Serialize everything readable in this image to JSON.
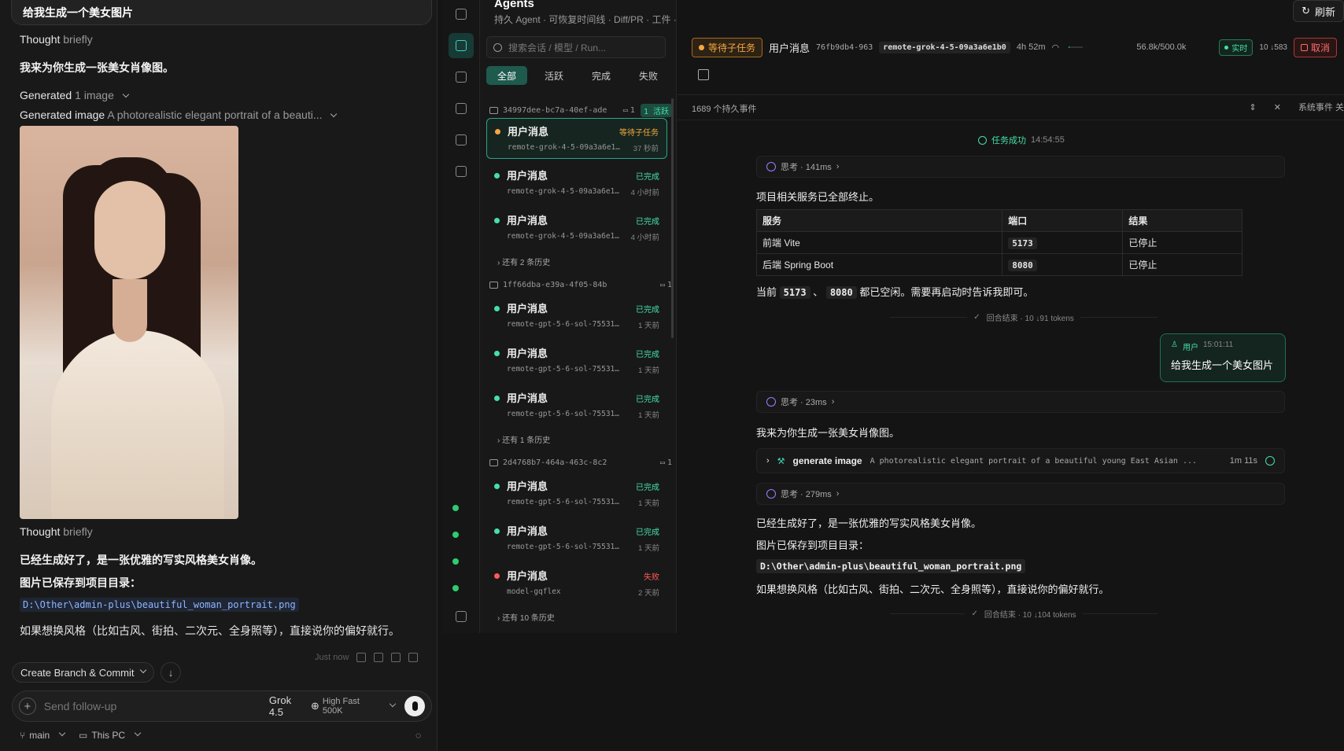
{
  "chat": {
    "user_prompt": "给我生成一个美女图片",
    "thought_label": "Thought",
    "thought_suffix": "briefly",
    "reply_intro": "我来为你生成一张美女肖像图。",
    "generated_label": "Generated",
    "generated_count": "1 image",
    "generated_image_label": "Generated image",
    "generated_image_desc": "A photorealistic elegant portrait of a beauti...",
    "thought2_label": "Thought",
    "thought2_suffix": "briefly",
    "reply_done": "已经生成好了，是一张优雅的写实风格美女肖像。",
    "reply_saved": "图片已保存到项目目录：",
    "file_path": "D:\\Other\\admin-plus\\beautiful_woman_portrait.png",
    "reply_style": "如果想换风格（比如古风、街拍、二次元、全身照等），直接说你的偏好就行。",
    "timestamp": "Just now",
    "branch_button": "Create Branch & Commit",
    "composer_placeholder": "Send follow-up",
    "model_name": "Grok 4.5",
    "model_mode": "High Fast 500K",
    "branch": "main",
    "location": "This PC"
  },
  "sessions": {
    "title": "Agents",
    "subtitle": "持久 Agent · 可恢复时间线 · Diff/PR · 工件 · 本地/远程交接",
    "search_placeholder": "搜索会话 / 模型 / Run...",
    "filters": [
      "全部",
      "活跃",
      "完成",
      "失败"
    ],
    "groups": [
      {
        "id": "34997dee-bc7a-40ef-ade",
        "count": "1",
        "active": "1 活跃"
      },
      {
        "id": "1ff66dba-e39a-4f05-84b",
        "count": "1"
      },
      {
        "id": "2d4768b7-464a-463c-8c2",
        "count": "1"
      }
    ],
    "items": [
      {
        "title": "用户消息",
        "status": "等待子任务",
        "sub": "remote-grok-4-5-09a3a6e1b0",
        "ago": "37 秒前"
      },
      {
        "title": "用户消息",
        "status": "已完成",
        "sub": "remote-grok-4-5-09a3a6e1b0",
        "ago": "4 小时前"
      },
      {
        "title": "用户消息",
        "status": "已完成",
        "sub": "remote-grok-4-5-09a3a6e1b0",
        "ago": "4 小时前"
      },
      {
        "title": "用户消息",
        "status": "已完成",
        "sub": "remote-gpt-5-6-sol-755311b",
        "ago": "1 天前"
      },
      {
        "title": "用户消息",
        "status": "已完成",
        "sub": "remote-gpt-5-6-sol-755311b",
        "ago": "1 天前"
      },
      {
        "title": "用户消息",
        "status": "已完成",
        "sub": "remote-gpt-5-6-sol-755311b",
        "ago": "1 天前"
      },
      {
        "title": "用户消息",
        "status": "已完成",
        "sub": "remote-gpt-5-6-sol-755311b",
        "ago": "1 天前"
      },
      {
        "title": "用户消息",
        "status": "已完成",
        "sub": "remote-gpt-5-6-sol-755311b",
        "ago": "1 天前"
      },
      {
        "title": "用户消息",
        "status": "失败",
        "sub": "model-gqflex",
        "ago": "2 天前"
      }
    ],
    "more": [
      "还有 2 条历史",
      "还有 1 条历史",
      "还有 10 条历史"
    ]
  },
  "task": {
    "refresh": "刷新",
    "waiting": "等待子任务",
    "msg_label": "用户消息",
    "msg_id": "76fb9db4-963",
    "run_id": "remote-grok-4-5-09a3a6e1b0",
    "elapsed": "4h 52m",
    "progress": 0.05,
    "tokens": "56.8k/500.0k",
    "realtime": "实时",
    "counts": "10 ↓583",
    "cancel": "取消",
    "event_count": "1689 个持久事件",
    "system_events": "系统事件 关",
    "success_label": "任务成功",
    "success_time": "14:54:55",
    "think1": "思考 · 141ms",
    "stopped": "项目相关服务已全部终止。",
    "table_headers": [
      "服务",
      "端口",
      "结果"
    ],
    "table_rows": [
      [
        "前端 Vite",
        "5173",
        "已停止"
      ],
      [
        "后端 Spring Boot",
        "8080",
        "已停止"
      ]
    ],
    "ports_prefix": "当前",
    "port_a": "5173",
    "port_sep": "、",
    "port_b": "8080",
    "ports_suffix": "都已空闲。需要再启动时告诉我即可。",
    "round_end1": "回合结束 · 10 ↓91 tokens",
    "user_label": "用户",
    "user_time": "15:01:11",
    "user_text": "给我生成一个美女图片",
    "think2": "思考 · 23ms",
    "intro": "我来为你生成一张美女肖像图。",
    "tool_name": "generate image",
    "tool_args": "A photorealistic elegant portrait of a beautiful young East Asian ...",
    "tool_dur": "1m 11s",
    "think3": "思考 · 279ms",
    "done": "已经生成好了，是一张优雅的写实风格美女肖像。",
    "saved": "图片已保存到项目目录：",
    "path": "D:\\Other\\admin-plus\\beautiful_woman_portrait.png",
    "style": "如果想换风格（比如古风、街拍、二次元、全身照等），直接说你的偏好就行。",
    "round_end2": "回合结束 · 10 ↓104 tokens"
  },
  "colors": {
    "accent": "#3fd3b8",
    "success": "#45e0a8",
    "waiting": "#f4a742",
    "failed": "#ff5a5a"
  }
}
